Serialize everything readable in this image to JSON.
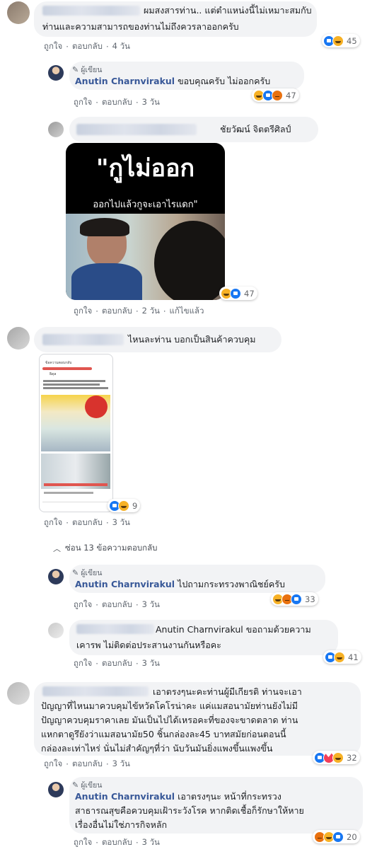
{
  "actions": {
    "like": "ถูกใจ",
    "reply": "ตอบกลับ",
    "edit": "แก้ไขแล้ว",
    "dot": "·"
  },
  "author_badge": "ผู้เขียน",
  "hide_replies": "ซ่อน 13 ข้อความตอบกลับ",
  "comments": [
    {
      "text_lines": [
        "ผมสงสารท่าน.. แต่ตำแหน่งนี้ไม่เหมาะสมกับ",
        "ท่านและความสามารถของท่านไม่ถึงควรลาออกครับ"
      ],
      "time": "4 วัน",
      "reactions": [
        "like",
        "haha"
      ],
      "count": "45"
    },
    {
      "name": "Anutin Charnvirakul",
      "text": "ขอบคุณครับ ไม่ออกครับ",
      "time": "3 วัน",
      "reactions": [
        "haha",
        "like",
        "angry"
      ],
      "count": "47"
    },
    {
      "name_visible": "ชัยวัฒน์ จิตตรีศิลป์",
      "meme_top": "\"กูไม่ออก",
      "meme_sub": "ออกไปแล้วกูจะเอาไรแดก\"",
      "time": "2 วัน",
      "reactions": [
        "haha",
        "like"
      ],
      "count": "47"
    },
    {
      "text": "ไหนละท่าน บอกเป็นสินค้าควบคุม",
      "screenshot_header": "ข้อความตอบกลับ",
      "screenshot_name": "ธิดุล",
      "time": "3 วัน",
      "reactions": [
        "like",
        "haha"
      ],
      "count": "9"
    },
    {
      "name": "Anutin Charnvirakul",
      "text": "ไปถามกระทรวงพาณิชย์ครับ",
      "time": "3 วัน",
      "reactions": [
        "haha",
        "angry",
        "like"
      ],
      "count": "33"
    },
    {
      "text_lines": [
        "Anutin Charnvirakul ขอถามด้วยความ",
        "เคารพ ไม่ติดต่อประสานงานกันหรือคะ"
      ],
      "time": "3 วัน",
      "reactions": [
        "like",
        "haha"
      ],
      "count": "41"
    },
    {
      "text_lines": [
        "เอาตรงๆนะคะท่านผู้มีเกียรติ ท่านจะเอา",
        "ปัญญาที่ไหนมาควบคุมไข้หวัดโคโรน่าคะ แค่แมสอนามัยท่านยังไม่มี",
        "ปัญญาควบคุมราคาเลย มันเป็นไปได้เหรอคะที่ของจะขาดตลาด ท่าน",
        "แหกตาดูรึยังว่าแมสอนามัย50 ชิ้นกล่องละ45 บาทสมัยก่อนตอนนี้",
        "กล่องละเท่าไหร่ นั่นไม่สำคัญๆที่ว่า นับวันมันยิ่งแพงขึ้นแพงขึ้น"
      ],
      "time": "3 วัน",
      "reactions": [
        "like",
        "love",
        "haha"
      ],
      "count": "32"
    },
    {
      "name": "Anutin Charnvirakul",
      "text_lines": [
        "เอาตรงๆนะ หน้าที่กระทรวง",
        "สาธารณสุขคือควบคุมเฝ้าระวังโรค หากติดเชื้อก็รักษาให้หาย",
        "เรื่องอื่นไม่ใช่ภารกิจหลัก"
      ],
      "time": "3 วัน",
      "reactions": [
        "angry",
        "haha",
        "like"
      ],
      "count": "20"
    }
  ]
}
